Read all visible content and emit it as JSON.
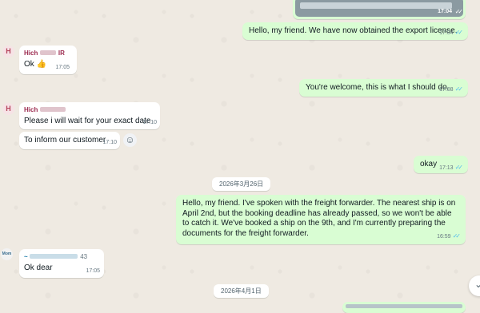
{
  "top_bubble": {
    "time": "17:04"
  },
  "messages": [
    {
      "text": "Hello, my friend. We have now obtained the export license.",
      "time": "17:04"
    },
    {
      "avatar": "H",
      "sender": "Hich",
      "sender_suffix": "IR",
      "text": "Ok 👍",
      "time": "17:05"
    },
    {
      "text": "You're welcome, this is what I should do.",
      "time": "17:08"
    },
    {
      "avatar": "H",
      "sender": "Hich",
      "text": "Please i will wait for your exact date",
      "time": "17:10"
    },
    {
      "text": "To inform our customer",
      "time": "17:10"
    },
    {
      "text": "okay",
      "time": "17:13"
    },
    {
      "text": "Hello, my friend. I've spoken with the freight forwarder. The nearest ship is on April 2nd, but the booking deadline has already passed, so we won't be able to catch it. We've booked a ship on the 9th, and I'm currently preparing the documents for the freight forwarder.",
      "time": "16:59"
    },
    {
      "avatar": "Mom",
      "sender": "~",
      "sender_suffix": "43",
      "text": "Ok dear",
      "time": "17:05"
    }
  ],
  "dates": [
    "2026年3月26日",
    "2026年4月1日"
  ],
  "icons": {
    "read": "double-check-icon",
    "react": "emoji-smile-icon",
    "scroll": "chevron-down-icon"
  }
}
